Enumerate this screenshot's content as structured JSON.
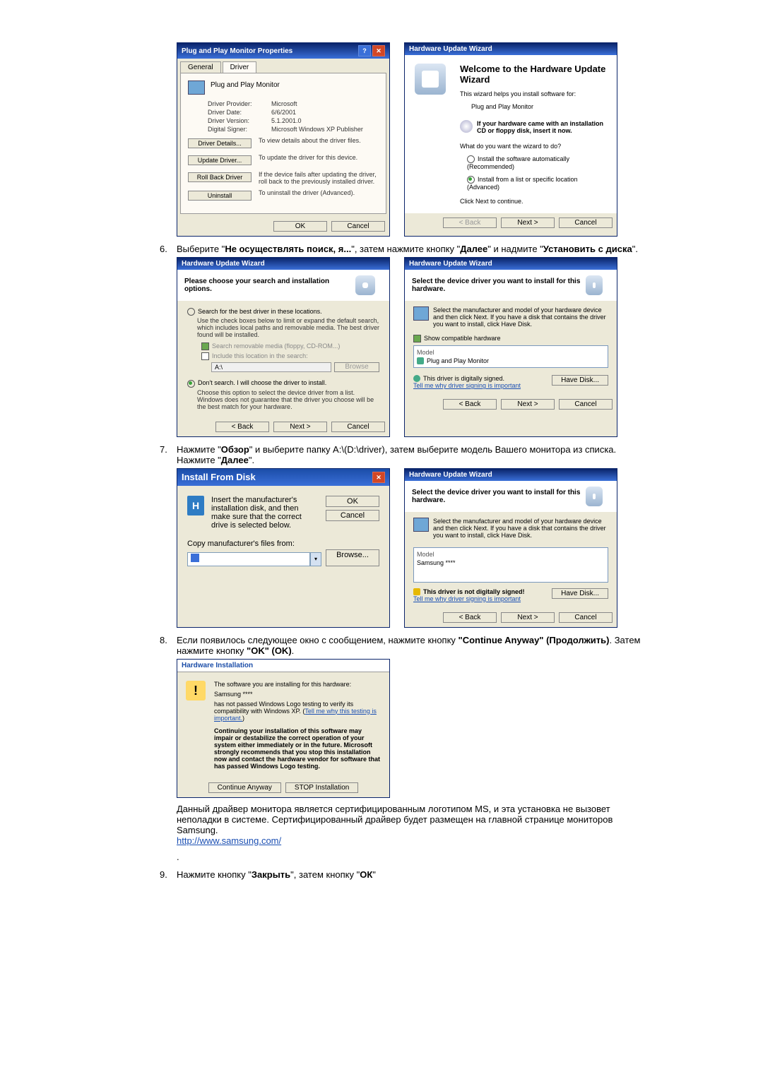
{
  "d1": {
    "title": "Plug and Play Monitor Properties",
    "tab_general": "General",
    "tab_driver": "Driver",
    "heading": "Plug and Play Monitor",
    "provider_k": "Driver Provider:",
    "provider_v": "Microsoft",
    "date_k": "Driver Date:",
    "date_v": "6/6/2001",
    "version_k": "Driver Version:",
    "version_v": "5.1.2001.0",
    "signer_k": "Digital Signer:",
    "signer_v": "Microsoft Windows XP Publisher",
    "btn_details": "Driver Details...",
    "txt_details": "To view details about the driver files.",
    "btn_update": "Update Driver...",
    "txt_update": "To update the driver for this device.",
    "btn_rollback": "Roll Back Driver",
    "txt_rollback": "If the device fails after updating the driver, roll back to the previously installed driver.",
    "btn_uninstall": "Uninstall",
    "txt_uninstall": "To uninstall the driver (Advanced).",
    "ok": "OK",
    "cancel": "Cancel"
  },
  "d2": {
    "title": "Hardware Update Wizard",
    "welcome": "Welcome to the Hardware Update Wizard",
    "line1": "This wizard helps you install software for:",
    "device": "Plug and Play Monitor",
    "cd_hint": "If your hardware came with an installation CD or floppy disk, insert it now.",
    "q": "What do you want the wizard to do?",
    "opt1": "Install the software automatically (Recommended)",
    "opt2": "Install from a list or specific location (Advanced)",
    "click_next": "Click Next to continue.",
    "back": "< Back",
    "next": "Next >",
    "cancel": "Cancel"
  },
  "step6": {
    "num": "6.",
    "a": "Выберите \"",
    "b": "Не осуществлять поиск, я...",
    "c": "\", затем нажмите кнопку \"",
    "d": "Далее",
    "e": "\" и надмите \"",
    "f": "Установить с диска",
    "g": "\"."
  },
  "d3": {
    "title": "Hardware Update Wizard",
    "heading": "Please choose your search and installation options.",
    "opt1": "Search for the best driver in these locations.",
    "opt1_desc": "Use the check boxes below to limit or expand the default search, which includes local paths and removable media. The best driver found will be installed.",
    "cb1": "Search removable media (floppy, CD-ROM...)",
    "cb2": "Include this location in the search:",
    "path": "A:\\",
    "browse": "Browse",
    "opt2": "Don't search. I will choose the driver to install.",
    "opt2_desc": "Choose this option to select the device driver from a list. Windows does not guarantee that the driver you choose will be the best match for your hardware.",
    "back": "< Back",
    "next": "Next >",
    "cancel": "Cancel"
  },
  "d4": {
    "title": "Hardware Update Wizard",
    "heading": "Select the device driver you want to install for this hardware.",
    "desc": "Select the manufacturer and model of your hardware device and then click Next. If you have a disk that contains the driver you want to install, click Have Disk.",
    "cb": "Show compatible hardware",
    "model_lbl": "Model",
    "model_val": "Plug and Play Monitor",
    "signed": "This driver is digitally signed.",
    "tell": "Tell me why driver signing is important",
    "have_disk": "Have Disk...",
    "back": "< Back",
    "next": "Next >",
    "cancel": "Cancel"
  },
  "step7": {
    "num": "7.",
    "a": "Нажмите \"",
    "b": "Обзор",
    "c": "\" и выберите папку A:\\(D:\\driver), затем выберите модель Вашего монитора из списка. Нажмите \"",
    "d": "Далее",
    "e": "\"."
  },
  "d5": {
    "title": "Install From Disk",
    "desc": "Insert the manufacturer's installation disk, and then make sure that the correct drive is selected below.",
    "ok": "OK",
    "cancel": "Cancel",
    "copy": "Copy manufacturer's files from:",
    "browse": "Browse..."
  },
  "d6": {
    "title": "Hardware Update Wizard",
    "heading": "Select the device driver you want to install for this hardware.",
    "desc": "Select the manufacturer and model of your hardware device and then click Next. If you have a disk that contains the driver you want to install, click Have Disk.",
    "model_lbl": "Model",
    "model_val": "Samsung ****",
    "unsigned": "This driver is not digitally signed!",
    "tell": "Tell me why driver signing is important",
    "have_disk": "Have Disk...",
    "back": "< Back",
    "next": "Next >",
    "cancel": "Cancel"
  },
  "step8": {
    "num": "8.",
    "a": "Если появилось следующее окно с сообщением, нажмите кнопку ",
    "b": "\"Continue Anyway\" (Продолжить)",
    "c": ". Затем нажмите кнопку ",
    "d": "\"OK\" (OK)",
    "e": "."
  },
  "d7": {
    "title": "Hardware Installation",
    "line1": "The software you are installing for this hardware:",
    "device": "Samsung ****",
    "line2a": "has not passed Windows Logo testing to verify its compatibility with Windows XP. (",
    "line2link": "Tell me why this testing is important.",
    "line2b": ")",
    "warn": "Continuing your installation of this software may impair or destabilize the correct operation of your system either immediately or in the future. Microsoft strongly recommends that you stop this installation now and contact the hardware vendor for software that has passed Windows Logo testing.",
    "cont": "Continue Anyway",
    "stop": "STOP Installation"
  },
  "para8": {
    "text": "Данный драйвер монитора является сертифицированным логотипом MS, и эта установка не вызовет неполадки в системе. Сертифицированный драйвер будет размещен на главной странице мониторов Samsung.",
    "link": "http://www.samsung.com/",
    "dot": "."
  },
  "step9": {
    "num": "9.",
    "a": "Нажмите кнопку \"",
    "b": "Закрыть",
    "c": "\", затем кнопку \"",
    "d": "ОК",
    "e": "\""
  }
}
